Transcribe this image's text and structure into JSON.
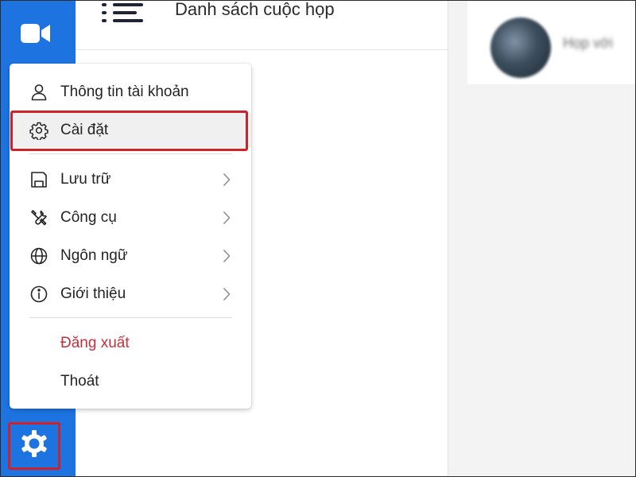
{
  "header": {
    "title": "Danh sách cuộc họp"
  },
  "menu": {
    "items": [
      {
        "label": "Thông tin tài khoản",
        "icon": "person-icon"
      },
      {
        "label": "Cài đặt",
        "icon": "gear-icon",
        "selected": true
      },
      {
        "label": "Lưu trữ",
        "icon": "save-icon",
        "submenu": true
      },
      {
        "label": "Công cụ",
        "icon": "tools-icon",
        "submenu": true
      },
      {
        "label": "Ngôn ngữ",
        "icon": "globe-icon",
        "submenu": true
      },
      {
        "label": "Giới thiệu",
        "icon": "info-icon",
        "submenu": true
      }
    ],
    "logout": "Đăng xuất",
    "exit": "Thoát"
  },
  "chat": {
    "name": "Họp với"
  },
  "colors": {
    "rail": "#1d74e0",
    "highlight": "#d0202a",
    "danger": "#c4313b"
  }
}
